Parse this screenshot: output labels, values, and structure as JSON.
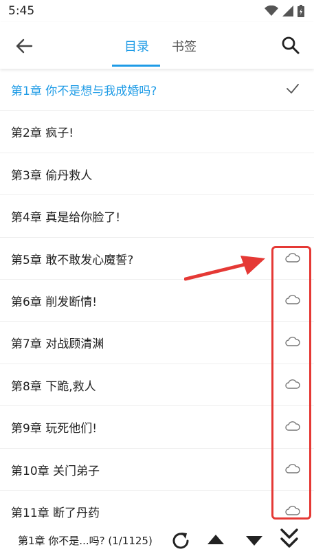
{
  "status_bar": {
    "time": "5:45",
    "icons": [
      "wifi-icon",
      "signal-icon",
      "battery-icon"
    ]
  },
  "header": {
    "tabs": [
      {
        "label": "目录",
        "active": true
      },
      {
        "label": "书签",
        "active": false
      }
    ],
    "back_icon": "back-arrow-icon",
    "search_icon": "search-icon",
    "accent_color": "#1e9be6"
  },
  "chapters": [
    {
      "title": "第1章 你不是想与我成婚吗?",
      "current": true,
      "trail_icon": "checkmark-icon"
    },
    {
      "title": "第2章 疯子!",
      "current": false
    },
    {
      "title": "第3章 偷丹救人",
      "current": false
    },
    {
      "title": "第4章 真是给你脸了!",
      "current": false
    },
    {
      "title": "第5章 敢不敢发心魔誓?",
      "current": false,
      "trail_icon": "cloud-icon"
    },
    {
      "title": "第6章 削发断情!",
      "current": false,
      "trail_icon": "cloud-icon"
    },
    {
      "title": "第7章 对战顾清渊",
      "current": false,
      "trail_icon": "cloud-icon"
    },
    {
      "title": "第8章 下跪,救人",
      "current": false,
      "trail_icon": "cloud-icon"
    },
    {
      "title": "第9章 玩死他们!",
      "current": false,
      "trail_icon": "cloud-icon"
    },
    {
      "title": "第10章 关门弟子",
      "current": false,
      "trail_icon": "cloud-icon"
    },
    {
      "title": "第11章 断了丹药",
      "current": false,
      "trail_icon": "cloud-icon"
    }
  ],
  "annotation": {
    "highlight_color": "#e53935"
  },
  "footer": {
    "progress_text": "第1章 你不是...吗? (1/1125)",
    "buttons": [
      "refresh-icon",
      "scroll-up-icon",
      "scroll-down-icon",
      "scroll-bottom-icon"
    ]
  }
}
